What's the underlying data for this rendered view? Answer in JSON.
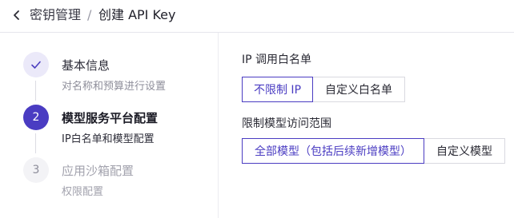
{
  "header": {
    "parent_label": "密钥管理",
    "separator": "/",
    "current_label": "创建 API Key",
    "back_icon": "chevron-left-icon"
  },
  "steps": [
    {
      "number": "1",
      "icon": "check-icon",
      "title": "基本信息",
      "subtitle": "对名称和预算进行设置",
      "state": "done"
    },
    {
      "number": "2",
      "title": "模型服务平台配置",
      "subtitle": "IP白名单和模型配置",
      "state": "active"
    },
    {
      "number": "3",
      "title": "应用沙箱配置",
      "subtitle": "权限配置",
      "state": "pending"
    }
  ],
  "form": {
    "ip_section": {
      "label": "IP 调用白名单",
      "options": [
        "不限制 IP",
        "自定义白名单"
      ],
      "selected": "不限制 IP"
    },
    "model_section": {
      "label": "限制模型访问范围",
      "options": [
        "全部模型（包括后续新增模型）",
        "自定义模型"
      ],
      "selected": "全部模型（包括后续新增模型）"
    }
  },
  "colors": {
    "accent": "#4a3cc2",
    "accent_light": "#ebe9f9",
    "border": "#d9d9e0"
  }
}
